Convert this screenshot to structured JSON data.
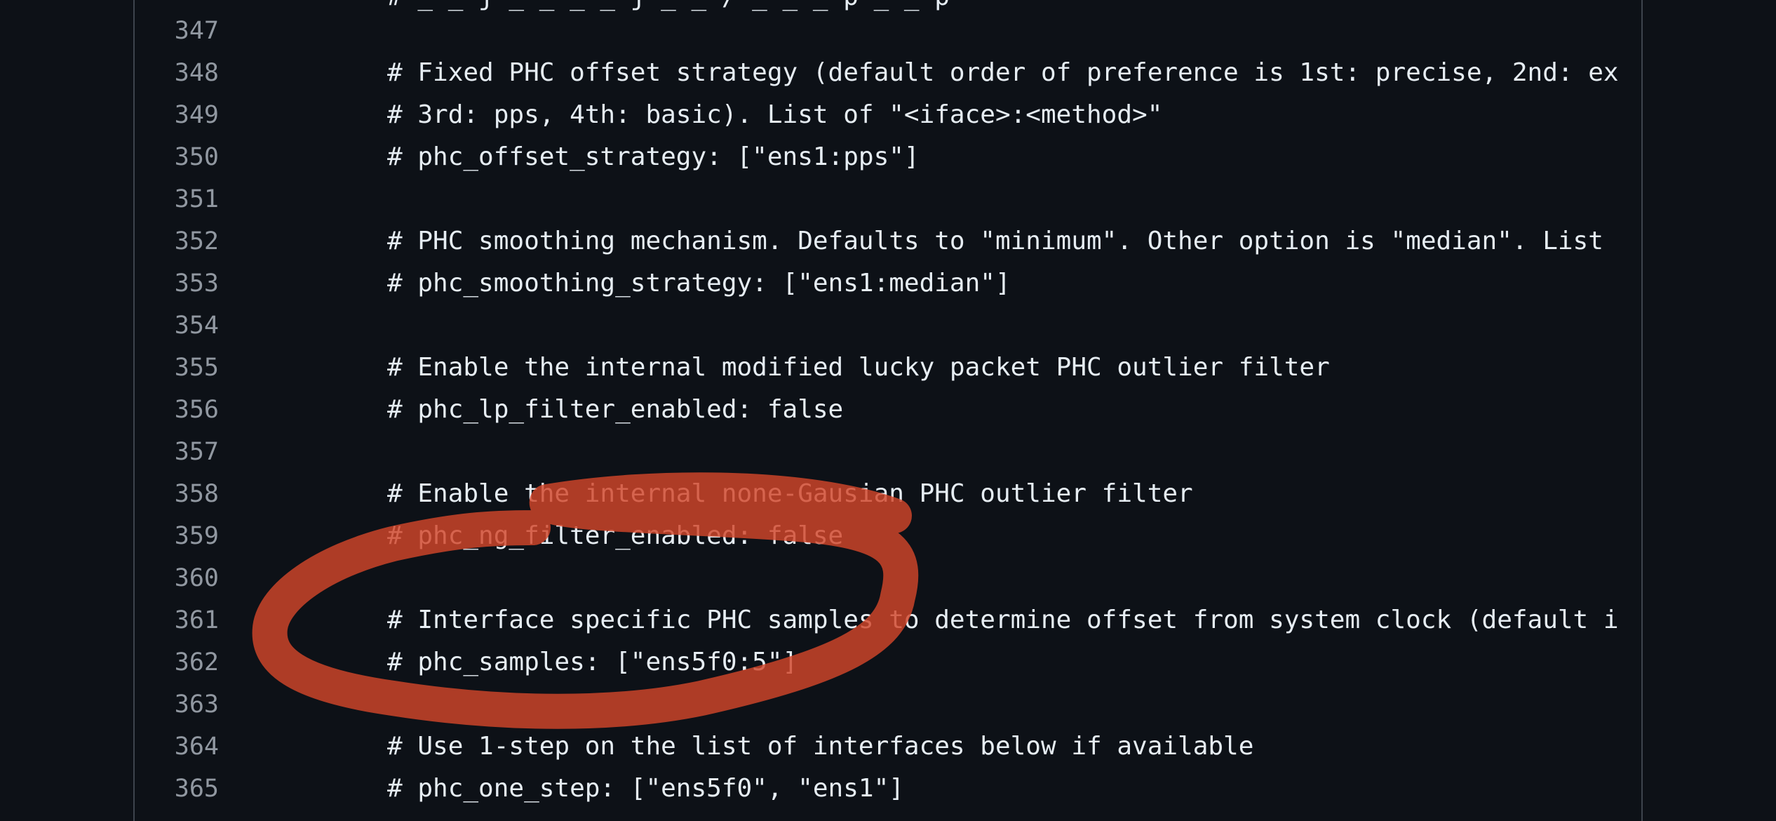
{
  "code_view": {
    "partial_top_line": "# _ _ j _ _ _ _ j _ _ / _ _ _ p _ _ p",
    "lines": [
      {
        "number": "347",
        "text": ""
      },
      {
        "number": "348",
        "text": "# Fixed PHC offset strategy (default order of preference is 1st: precise, 2nd: ex"
      },
      {
        "number": "349",
        "text": "# 3rd: pps, 4th: basic). List of \"<iface>:<method>\""
      },
      {
        "number": "350",
        "text": "# phc_offset_strategy: [\"ens1:pps\"]"
      },
      {
        "number": "351",
        "text": ""
      },
      {
        "number": "352",
        "text": "# PHC smoothing mechanism. Defaults to \"minimum\". Other option is \"median\". List"
      },
      {
        "number": "353",
        "text": "# phc_smoothing_strategy: [\"ens1:median\"]"
      },
      {
        "number": "354",
        "text": ""
      },
      {
        "number": "355",
        "text": "# Enable the internal modified lucky packet PHC outlier filter"
      },
      {
        "number": "356",
        "text": "# phc_lp_filter_enabled: false"
      },
      {
        "number": "357",
        "text": ""
      },
      {
        "number": "358",
        "text": "# Enable the internal none-Gausian PHC outlier filter"
      },
      {
        "number": "359",
        "text": "# phc_ng_filter_enabled: false"
      },
      {
        "number": "360",
        "text": ""
      },
      {
        "number": "361",
        "text": "# Interface specific PHC samples to determine offset from system clock (default i"
      },
      {
        "number": "362",
        "text": "# phc_samples: [\"ens5f0:5\"]"
      },
      {
        "number": "363",
        "text": ""
      },
      {
        "number": "364",
        "text": "# Use 1-step on the list of interfaces below if available"
      },
      {
        "number": "365",
        "text": "# phc_one_step: [\"ens5f0\", \"ens1\"]"
      }
    ]
  },
  "colors": {
    "background": "#0d1117",
    "text": "#e6edf3",
    "line_number": "#9198a1",
    "annotation_stroke": "#d2462a"
  }
}
